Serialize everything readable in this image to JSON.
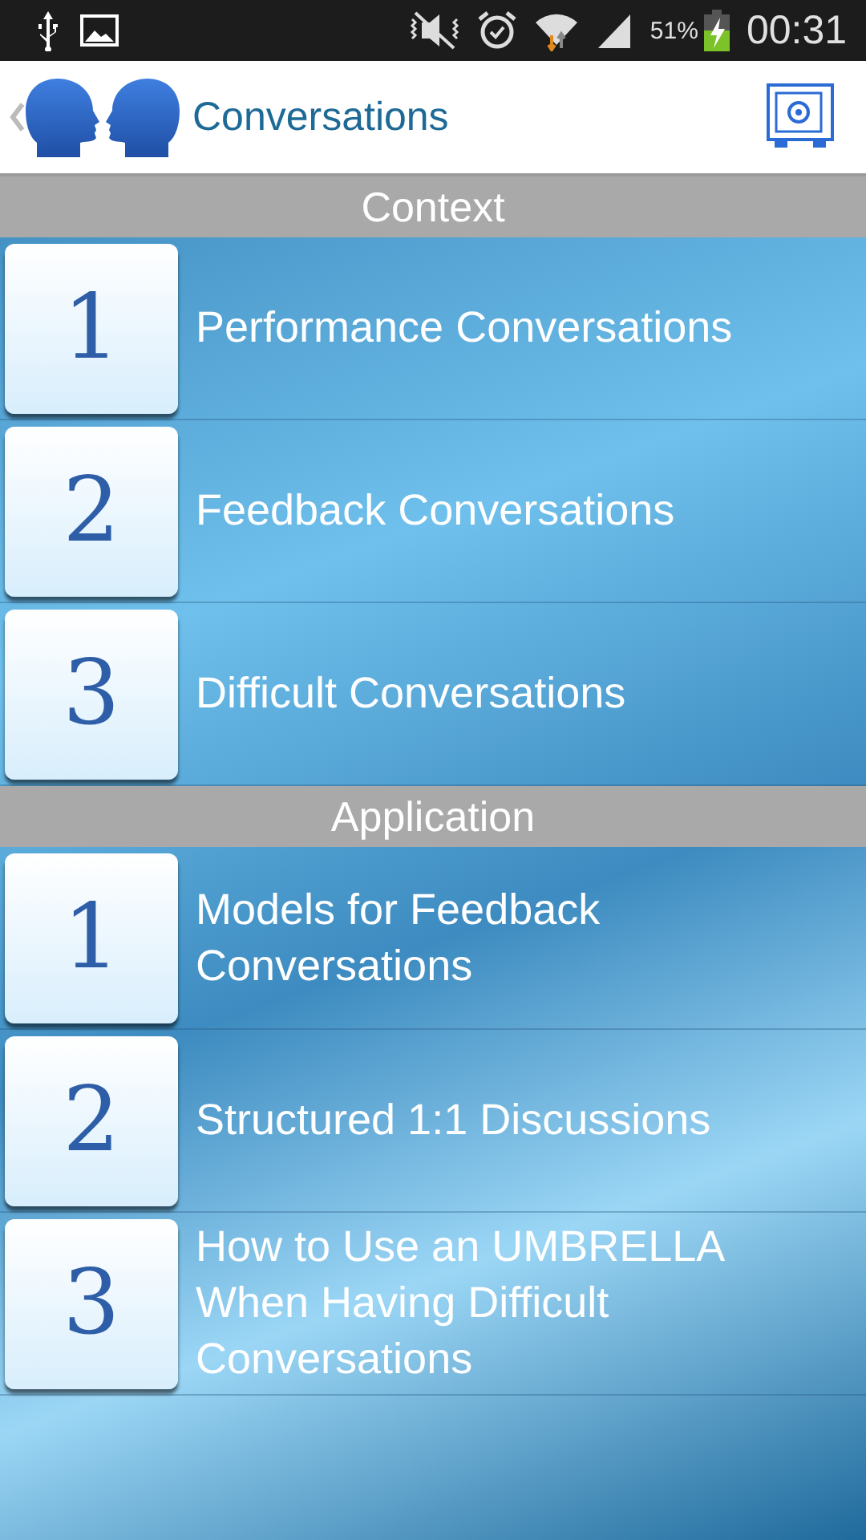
{
  "status_bar": {
    "battery": "51%",
    "time": "00:31"
  },
  "header": {
    "title": "Conversations"
  },
  "sections": [
    {
      "title": "Context",
      "items": [
        {
          "number": "1",
          "label": "Performance Conversations"
        },
        {
          "number": "2",
          "label": "Feedback Conversations"
        },
        {
          "number": "3",
          "label": "Difficult Conversations"
        }
      ]
    },
    {
      "title": "Application",
      "items": [
        {
          "number": "1",
          "label": "Models for Feedback Conversations"
        },
        {
          "number": "2",
          "label": "Structured 1:1 Discussions"
        },
        {
          "number": "3",
          "label": "How to Use an UMBRELLA When Having Difficult Conversations"
        }
      ]
    }
  ]
}
